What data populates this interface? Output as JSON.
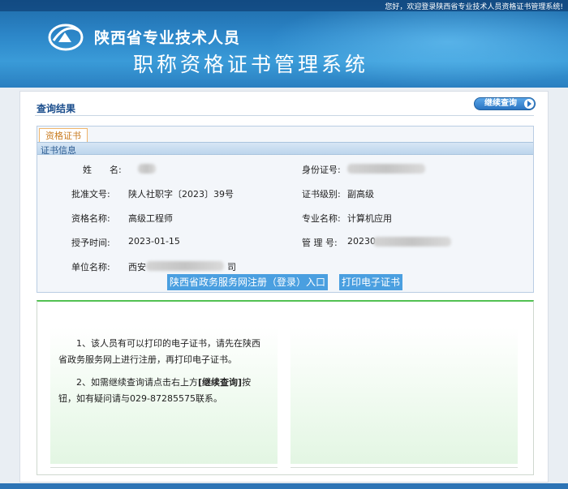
{
  "header": {
    "welcome": "您好，欢迎登录陕西省专业技术人员资格证书管理系统!",
    "title_line1": "陕西省专业技术人员",
    "title_line2": "职称资格证书管理系统"
  },
  "result": {
    "title": "查询结果",
    "continue_label": "继续查询"
  },
  "certificate": {
    "tab_label": "资格证书",
    "section_label": "证书信息",
    "fields": {
      "name_label": "姓　　名:",
      "id_label": "身份证号:",
      "approval_label": "批准文号:",
      "approval_value": "陕人社职字〔2023〕39号",
      "level_label": "证书级别:",
      "level_value": "副高级",
      "qualification_label": "资格名称:",
      "qualification_value": "高级工程师",
      "major_label": "专业名称:",
      "major_value": "计算机应用",
      "date_label": "授予时间:",
      "date_value": "2023-01-15",
      "manage_label": "管 理 号:",
      "manage_value_prefix": "20230",
      "unit_label": "单位名称:",
      "unit_value_prefix": "西安",
      "unit_value_suffix": "司"
    },
    "gov_button": "陕西省政务服务网注册（登录）入口",
    "print_button": "打印电子证书"
  },
  "notice": {
    "line1a": "1、该人员有可以打印的电子证书，请先在陕西",
    "line1b": "省政务服务网上进行注册，再打印电子证书。",
    "line2a_pre": "2、如需继续查询请点击右上方",
    "line2a_bold": "[继续查询]",
    "line2a_post": "按",
    "line2b": "钮，如有疑问请与029-87285575联系。"
  },
  "colors": {
    "brand_blue": "#2c86c8",
    "accent_orange": "#f0b56b",
    "notice_green": "#52c152",
    "button_blue": "#4a9fe0"
  }
}
